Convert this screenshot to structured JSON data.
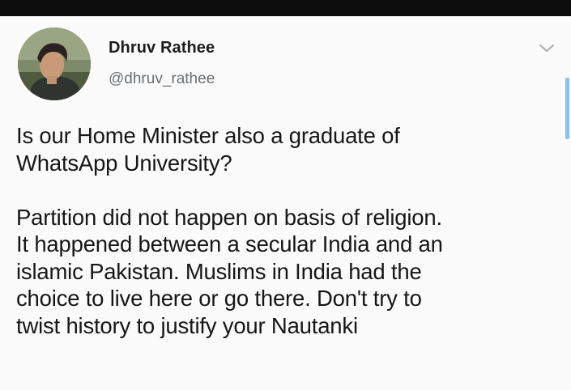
{
  "author": {
    "display_name": "Dhruv Rathee",
    "handle": "@dhruv_rathee"
  },
  "tweet": {
    "paragraphs": [
      [
        "Is our Home Minister also a graduate of",
        "WhatsApp University?"
      ],
      [
        "Partition did not happen on basis of religion.",
        "It happened between a secular India and an",
        "islamic Pakistan. Muslims in India had the",
        "choice to live here or go there. Don't try to",
        "twist history to justify your Nautanki"
      ]
    ]
  },
  "icons": {
    "more": "chevron-down-icon",
    "avatar": "profile-photo"
  },
  "colors": {
    "top_bar": "#0c0c0c",
    "name": "#1c1c1c",
    "handle": "#6b6f73",
    "text": "#161616",
    "scroll_thumb": "#8cc0ec"
  }
}
